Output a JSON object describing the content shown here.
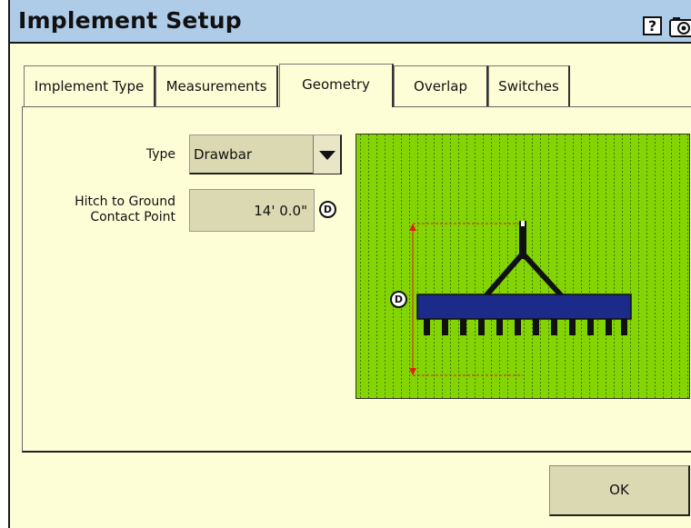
{
  "window": {
    "title": "Implement Setup"
  },
  "titlebar": {
    "help_label": "?",
    "camera_icon": "camera-icon"
  },
  "tabs": [
    {
      "label": "Implement Type",
      "active": false
    },
    {
      "label": "Measurements",
      "active": false
    },
    {
      "label": "Geometry",
      "active": true
    },
    {
      "label": "Overlap",
      "active": false
    },
    {
      "label": "Switches",
      "active": false
    }
  ],
  "form": {
    "type_label": "Type",
    "type_value": "Drawbar",
    "hitch_label_line1": "Hitch to Ground",
    "hitch_label_line2": "Contact Point",
    "hitch_value": "14' 0.0\"",
    "hitch_badge": "D"
  },
  "diagram": {
    "dimension_badge": "D",
    "colors": {
      "field": "#84d404",
      "implement": "#1c2a8a",
      "dimension": "#e02010",
      "tines": "#111111"
    }
  },
  "footer": {
    "ok_label": "OK"
  }
}
